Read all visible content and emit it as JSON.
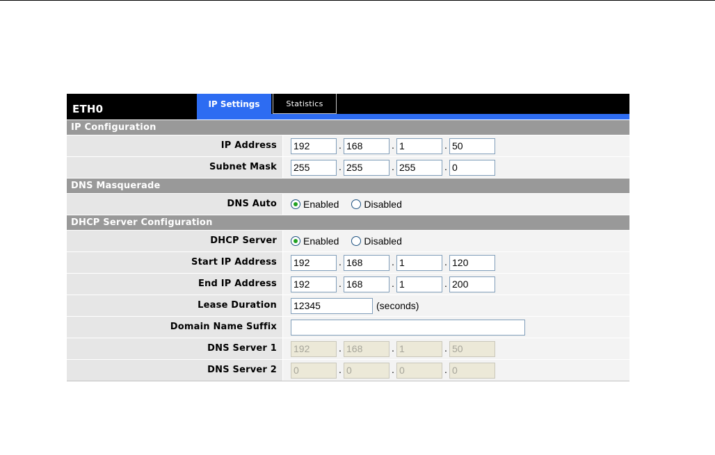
{
  "header": {
    "title": "ETH0",
    "tabs": [
      {
        "label": "IP Settings",
        "active": true
      },
      {
        "label": "Statistics",
        "active": false
      }
    ]
  },
  "sections": {
    "ip_config": "IP Configuration",
    "dns_masq": "DNS Masquerade",
    "dhcp_config": "DHCP Server Configuration"
  },
  "ip_address": {
    "label": "IP Address",
    "octets": [
      "192",
      "168",
      "1",
      "50"
    ]
  },
  "subnet_mask": {
    "label": "Subnet Mask",
    "octets": [
      "255",
      "255",
      "255",
      "0"
    ]
  },
  "dns_auto": {
    "label": "DNS Auto",
    "options": [
      "Enabled",
      "Disabled"
    ],
    "selected": "Enabled"
  },
  "dhcp_server": {
    "label": "DHCP Server",
    "options": [
      "Enabled",
      "Disabled"
    ],
    "selected": "Enabled"
  },
  "start_ip": {
    "label": "Start IP Address",
    "octets": [
      "192",
      "168",
      "1",
      "120"
    ]
  },
  "end_ip": {
    "label": "End IP Address",
    "octets": [
      "192",
      "168",
      "1",
      "200"
    ]
  },
  "lease": {
    "label": "Lease Duration",
    "value": "12345",
    "unit": "(seconds)"
  },
  "domain_suffix": {
    "label": "Domain Name Suffix",
    "value": ""
  },
  "dns1": {
    "label": "DNS Server 1",
    "octets": [
      "192",
      "168",
      "1",
      "50"
    ],
    "disabled": true
  },
  "dns2": {
    "label": "DNS Server 2",
    "octets": [
      "0",
      "0",
      "0",
      "0"
    ],
    "disabled": true
  },
  "colors": {
    "tab_active": "#2d6cf2",
    "section_bg": "#999999",
    "label_bg": "#e6e6e6",
    "radio_dot": "#21a121"
  }
}
